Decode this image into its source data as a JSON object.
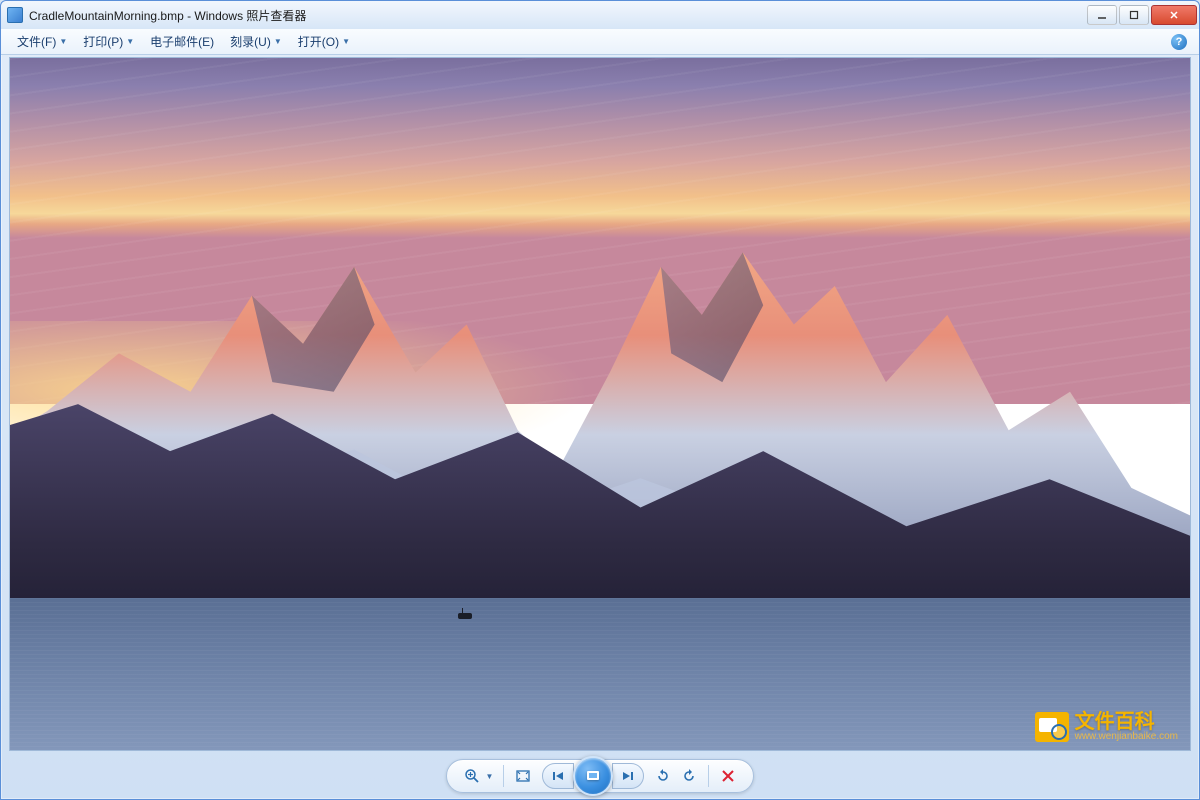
{
  "titlebar": {
    "filename": "CradleMountainMorning.bmp",
    "separator": " - ",
    "app_name": "Windows 照片查看器"
  },
  "menu": {
    "file": "文件(F)",
    "print": "打印(P)",
    "email": "电子邮件(E)",
    "burn": "刻录(U)",
    "open": "打开(O)"
  },
  "help_glyph": "?",
  "watermark": {
    "title": "文件百科",
    "url": "www.wenjianbaike.com"
  },
  "toolbar": {
    "zoom": "zoom",
    "fit": "fit",
    "prev": "previous",
    "play": "slideshow",
    "next": "next",
    "rotate_ccw": "rotate-left",
    "rotate_cw": "rotate-right",
    "delete": "delete"
  }
}
